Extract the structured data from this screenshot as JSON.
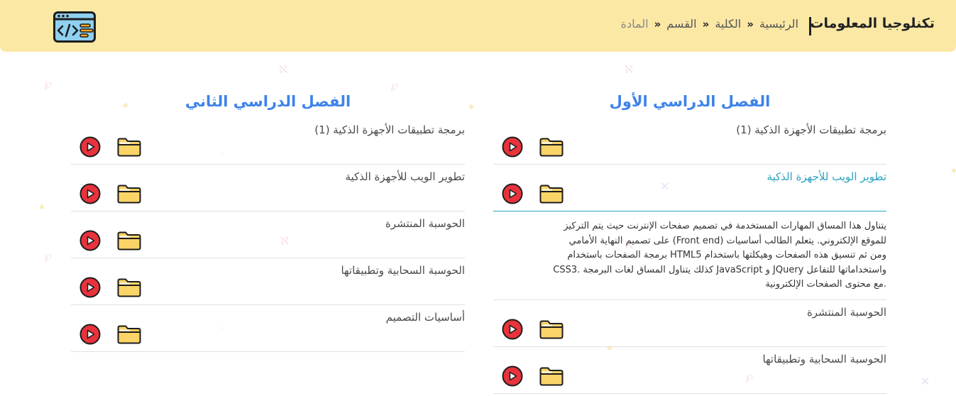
{
  "header": {
    "brand": "تكنلوجيا المعلومات",
    "breadcrumbs": [
      "الرئيسية",
      "الكلية",
      "القسم",
      "المادة"
    ]
  },
  "columns": [
    {
      "title": "الفصل الدراسي الثاني",
      "courses": [
        "برمجة تطبيقات الأجهزة الذكية (1)",
        "تطوير الويب للأجهزة الذكية",
        "الحوسبة المنتشرة",
        "الحوسبة السحابية وتطبيقاتها",
        "أساسيات التصميم"
      ]
    },
    {
      "title": "الفصل الدراسي الأول",
      "courses": [
        "برمجة تطبيقات الأجهزة الذكية (1)",
        "تطوير الويب للأجهزة الذكية",
        "الحوسبة المنتشرة",
        "الحوسبة السحابية وتطبيقاتها"
      ],
      "description_lines": [
        "يتناول هذا المساق المهارات المستخدمة في تصميم صفحات الإنترنت حيث يتم التركيز",
        "للموقع الإلكتروني. يتعلم الطالب أساسيات (Front end) على تصميم النهاية الأمامي",
        "ومن ثم تنسيق هذه الصفحات وهيكلتها باستخدام HTML5 برمجة الصفحات باستخدام",
        "واستخداماتها للتفاعل JQuery و JavaScript كذلك يتناول المساق لغات البرمجة .CSS3",
        ".مع محتوى الصفحات الإلكترونية"
      ]
    }
  ],
  "icons": {
    "logo": "code-window-icon",
    "play": "play-icon",
    "folder": "folder-icon",
    "separator": "double-chevron-icon"
  },
  "colors": {
    "header_bg": "#fbe8a4",
    "title": "#3d83ea",
    "active": "#2aa3c0",
    "play": "#e8323c",
    "folder": "#fbd468"
  }
}
